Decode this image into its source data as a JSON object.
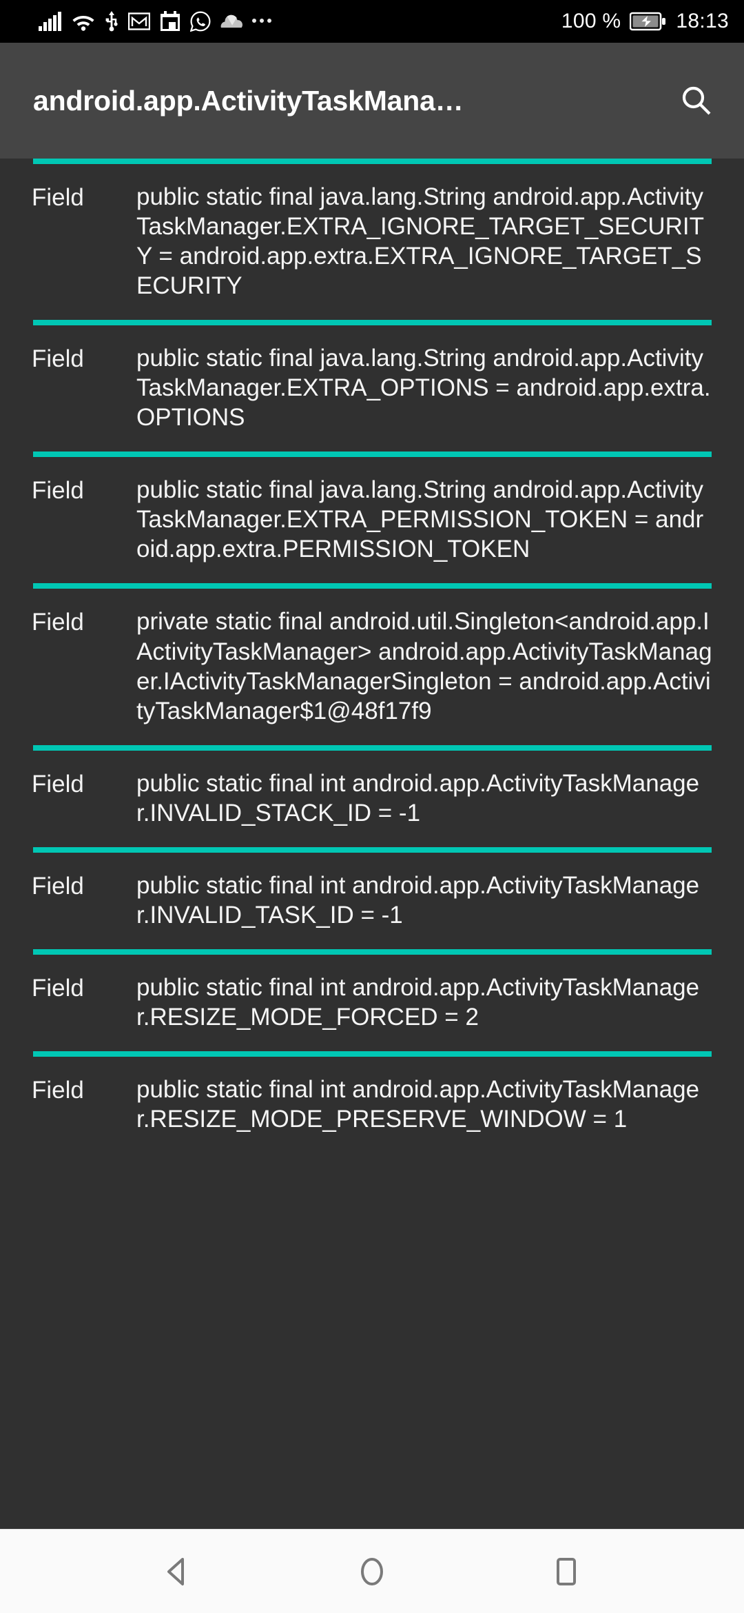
{
  "status_bar": {
    "icons": [
      "signal-bars-icon",
      "wifi-icon",
      "usb-icon",
      "gmail-icon",
      "calendar-icon",
      "whatsapp-icon",
      "cloud-icon",
      "overflow-dots-icon"
    ],
    "battery_percent": "100 %",
    "battery_state": "charging",
    "time": "18:13"
  },
  "toolbar": {
    "title": "android.app.ActivityTaskMana…",
    "search_icon": "search-icon"
  },
  "colors": {
    "accent": "#00c7b4",
    "toolbar_bg": "#454545",
    "content_bg": "#303030",
    "status_bg": "#000000",
    "navbar_bg": "#fafafa",
    "text": "#f5f5f5"
  },
  "list": {
    "items": [
      {
        "kind": "Field",
        "value": "public static final java.lang.String android.app.ActivityTaskManager.EXTRA_IGNORE_TARGET_SECURITY = android.app.extra.EXTRA_IGNORE_TARGET_SECURITY"
      },
      {
        "kind": "Field",
        "value": "public static final java.lang.String android.app.ActivityTaskManager.EXTRA_OPTIONS = android.app.extra.OPTIONS"
      },
      {
        "kind": "Field",
        "value": "public static final java.lang.String android.app.ActivityTaskManager.EXTRA_PERMISSION_TOKEN = android.app.extra.PERMISSION_TOKEN"
      },
      {
        "kind": "Field",
        "value": "private static final android.util.Singleton<android.app.IActivityTaskManager> android.app.ActivityTaskManager.IActivityTaskManagerSingleton = android.app.ActivityTaskManager$1@48f17f9"
      },
      {
        "kind": "Field",
        "value": "public static final int android.app.ActivityTaskManager.INVALID_STACK_ID = -1"
      },
      {
        "kind": "Field",
        "value": "public static final int android.app.ActivityTaskManager.INVALID_TASK_ID = -1"
      },
      {
        "kind": "Field",
        "value": "public static final int android.app.ActivityTaskManager.RESIZE_MODE_FORCED = 2"
      },
      {
        "kind": "Field",
        "value": "public static final int android.app.ActivityTaskManager.RESIZE_MODE_PRESERVE_WINDOW = 1"
      }
    ]
  },
  "navbar": {
    "back_label": "back-triangle-icon",
    "home_label": "home-circle-icon",
    "recents_label": "recents-square-icon"
  }
}
